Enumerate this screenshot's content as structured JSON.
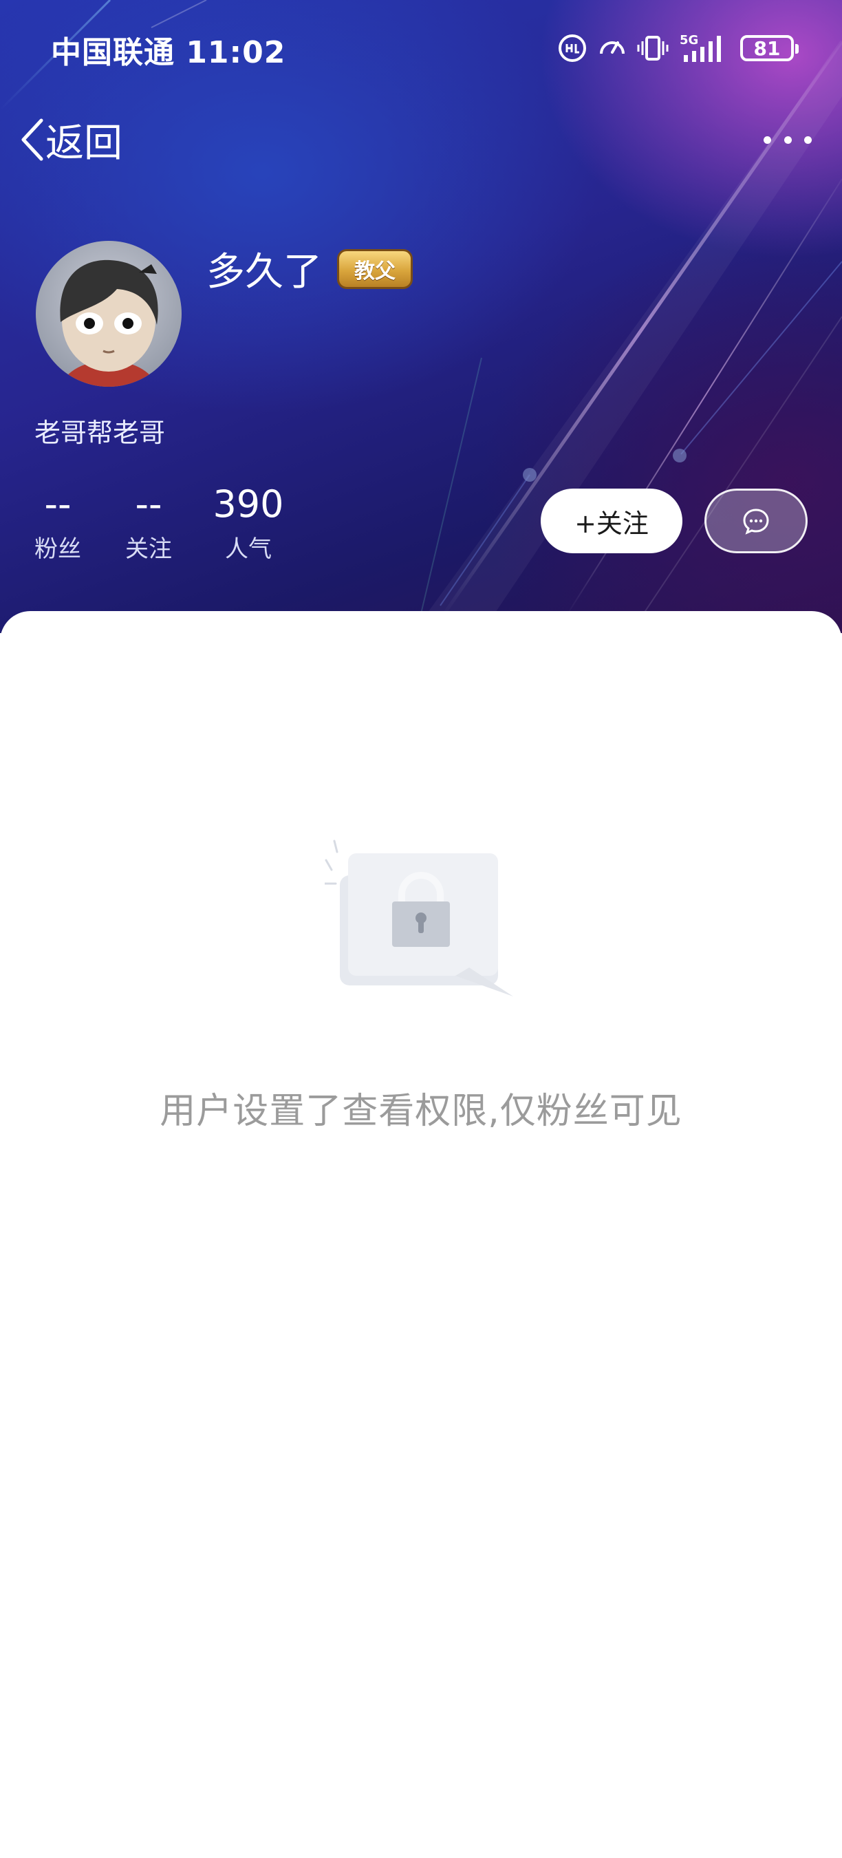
{
  "status_bar": {
    "carrier_time": "中国联通 11:02",
    "network": "5G",
    "battery": "81",
    "icons": [
      "hd-call-icon",
      "speed-icon",
      "vibrate-icon",
      "signal-icon",
      "battery-icon"
    ]
  },
  "nav": {
    "back_label": "返回",
    "more_icon": "more-icon"
  },
  "profile": {
    "username": "多久了",
    "badge": "教父",
    "signature": "老哥帮老哥",
    "avatar": "avatar"
  },
  "stats": {
    "fans": {
      "value": "--",
      "label": "粉丝"
    },
    "following": {
      "value": "--",
      "label": "关注"
    },
    "popularity": {
      "value": "390",
      "label": "人气"
    }
  },
  "actions": {
    "follow_label": "+关注",
    "message_icon": "chat-icon"
  },
  "content": {
    "empty_message": "用户设置了查看权限,仅粉丝可见",
    "illustration_icon": "lock-icon"
  },
  "colors": {
    "header_blue": "#27258f",
    "header_purple": "#d654d6",
    "empty_text": "#9b9b9b",
    "badge_gold": "#d9a53c"
  }
}
